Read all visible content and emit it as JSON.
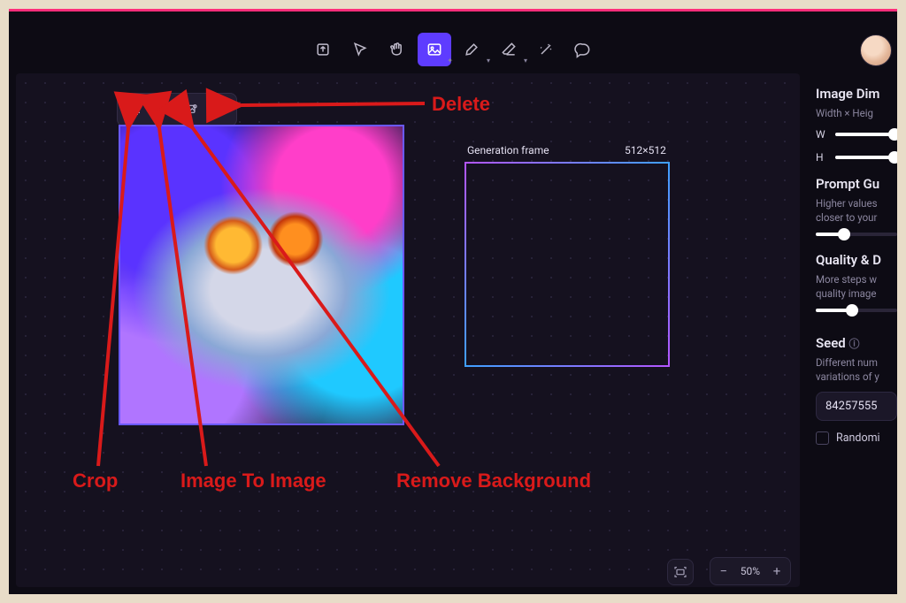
{
  "toolbar": {
    "tools": [
      "export",
      "select",
      "pan",
      "image",
      "brush",
      "erase",
      "wand",
      "comment"
    ]
  },
  "context_bar": {
    "buttons": [
      "crop",
      "image-to-image",
      "remove-bg",
      "delete"
    ]
  },
  "generation_frame": {
    "label": "Generation frame",
    "dimensions": "512×512"
  },
  "zoom": {
    "value": "50%",
    "minus": "−",
    "plus": "+"
  },
  "side_panel": {
    "dim_title": "Image Dim",
    "dim_sub": "Width × Heig",
    "w_label": "W",
    "h_label": "H",
    "guidance_title": "Prompt Gu",
    "guidance_sub1": "Higher values",
    "guidance_sub2": "closer to your",
    "quality_title": "Quality & D",
    "quality_sub1": "More steps w",
    "quality_sub2": "quality image",
    "seed_title": "Seed",
    "seed_sub1": "Different num",
    "seed_sub2": "variations of y",
    "seed_value": "84257555",
    "randomize": "Randomi"
  },
  "annotations": {
    "delete": "Delete",
    "crop": "Crop",
    "i2i": "Image To Image",
    "removebg": "Remove Background"
  }
}
